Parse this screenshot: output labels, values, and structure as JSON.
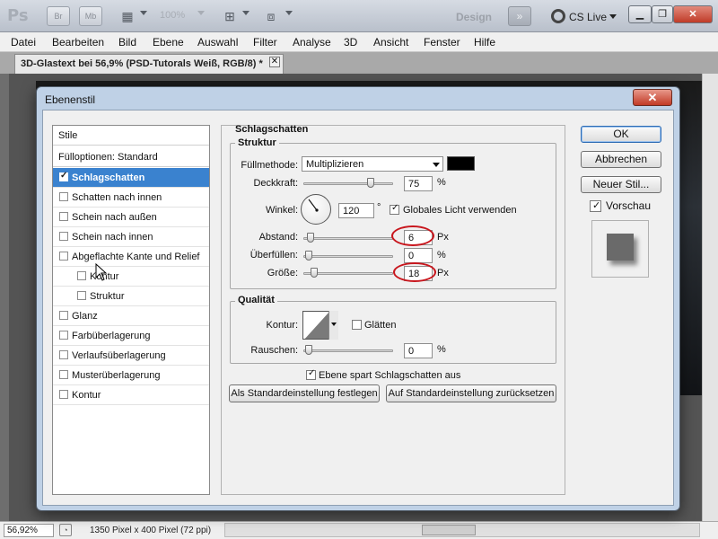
{
  "app": {
    "logo": "Ps",
    "zoom_field": "100%",
    "workspace_label": "Design",
    "cs_live_label": "CS Live",
    "toolbar_mini": [
      "Br",
      "Mb"
    ]
  },
  "menu": [
    "Datei",
    "Bearbeiten",
    "Bild",
    "Ebene",
    "Auswahl",
    "Filter",
    "Analyse",
    "3D",
    "Ansicht",
    "Fenster",
    "Hilfe"
  ],
  "document": {
    "tab_title": "3D-Glastext bei 56,9% (PSD-Tutorals Weiß, RGB/8) *"
  },
  "status": {
    "zoom": "56,92%",
    "doc_info": "1350 Pixel x 400 Pixel (72 ppi)"
  },
  "dialog": {
    "title": "Ebenenstil",
    "style_list": {
      "header": "Stile",
      "blend_options": "Fülloptionen: Standard",
      "items": [
        {
          "label": "Schlagschatten",
          "checked": true,
          "selected": true,
          "indent": false
        },
        {
          "label": "Schatten nach innen",
          "checked": false,
          "selected": false,
          "indent": false
        },
        {
          "label": "Schein nach außen",
          "checked": false,
          "selected": false,
          "indent": false
        },
        {
          "label": "Schein nach innen",
          "checked": false,
          "selected": false,
          "indent": false
        },
        {
          "label": "Abgeflachte Kante und Relief",
          "checked": false,
          "selected": false,
          "indent": false
        },
        {
          "label": "Kontur",
          "checked": false,
          "selected": false,
          "indent": true
        },
        {
          "label": "Struktur",
          "checked": false,
          "selected": false,
          "indent": true
        },
        {
          "label": "Glanz",
          "checked": false,
          "selected": false,
          "indent": false
        },
        {
          "label": "Farbüberlagerung",
          "checked": false,
          "selected": false,
          "indent": false
        },
        {
          "label": "Verlaufsüberlagerung",
          "checked": false,
          "selected": false,
          "indent": false
        },
        {
          "label": "Musterüberlagerung",
          "checked": false,
          "selected": false,
          "indent": false
        },
        {
          "label": "Kontur",
          "checked": false,
          "selected": false,
          "indent": false
        }
      ]
    },
    "panel": {
      "title": "Schlagschatten",
      "structure": {
        "legend": "Struktur",
        "blend_mode_label": "Füllmethode:",
        "blend_mode_value": "Multiplizieren",
        "shadow_color": "#000000",
        "opacity_label": "Deckkraft:",
        "opacity_value": "75",
        "opacity_unit": "%",
        "opacity_level": 75,
        "angle_label": "Winkel:",
        "angle_value": "120",
        "angle_unit": "°",
        "global_light_label": "Globales Licht verwenden",
        "global_light_checked": true,
        "distance_label": "Abstand:",
        "distance_value": "6",
        "distance_unit": "Px",
        "distance_level": 0.02,
        "spread_label": "Überfüllen:",
        "spread_value": "0",
        "spread_unit": "%",
        "spread_level": 0,
        "size_label": "Größe:",
        "size_value": "18",
        "size_unit": "Px",
        "size_level": 0.07
      },
      "quality": {
        "legend": "Qualität",
        "contour_label": "Kontur:",
        "antialias_label": "Glätten",
        "antialias_checked": false,
        "noise_label": "Rauschen:",
        "noise_value": "0",
        "noise_unit": "%",
        "noise_level": 0
      },
      "knockout_label": "Ebene spart Schlagschatten aus",
      "knockout_checked": true,
      "make_default_button": "Als Standardeinstellung festlegen",
      "reset_default_button": "Auf Standardeinstellung zurücksetzen"
    },
    "buttons": {
      "ok": "OK",
      "cancel": "Abbrechen",
      "new_style": "Neuer Stil...",
      "preview_label": "Vorschau",
      "preview_checked": true
    }
  }
}
